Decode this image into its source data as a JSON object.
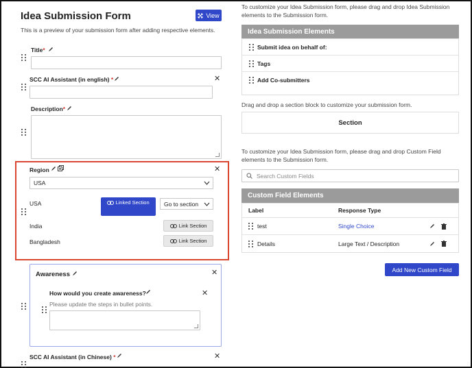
{
  "form": {
    "title": "Idea Submission Form",
    "view_label": "View",
    "subtitle": "This is a preview of your submission form after adding respective elements.",
    "fields": {
      "title_label": "Title",
      "scc_label": "SCC AI Assistant (in english)",
      "description_label": "Description",
      "required_mark": "*"
    },
    "region": {
      "label": "Region",
      "selected": "USA",
      "options": [
        {
          "name": "USA",
          "button": "Linked Section",
          "goto": "Go to section"
        },
        {
          "name": "India",
          "button": "Link Section"
        },
        {
          "name": "Bangladesh",
          "button": "Link Section"
        }
      ]
    },
    "awareness": {
      "label": "Awareness",
      "question": "How would you create awareness?",
      "placeholder": "Please update the steps in bullet points."
    },
    "scc_chinese_label": "SCC AI Assistant (in Chinese)"
  },
  "right": {
    "intro": "To customize your Idea Submission form, please drag and drop Idea Submission elements to the Submission form.",
    "elements_header": "Idea Submission Elements",
    "elements": [
      "Submit idea on behalf of:",
      "Tags",
      "Add Co-submitters"
    ],
    "section_hint": "Drag and drop a section block to customize your submission form.",
    "section_label": "Section",
    "custom_intro": "To customize your Idea Submission form, please drag and drop Custom Field elements to the Submission form.",
    "search_placeholder": "Search Custom Fields",
    "custom_header": "Custom Field Elements",
    "columns": {
      "label": "Label",
      "response": "Response Type"
    },
    "custom_rows": [
      {
        "label": "test",
        "response": "Single Choice"
      },
      {
        "label": "Details",
        "response": "Large Text / Description"
      }
    ],
    "add_button": "Add New Custom Field"
  },
  "colors": {
    "accent": "#2f47c8",
    "highlight_border": "#d9452f",
    "panel_header": "#9b9b9b"
  }
}
